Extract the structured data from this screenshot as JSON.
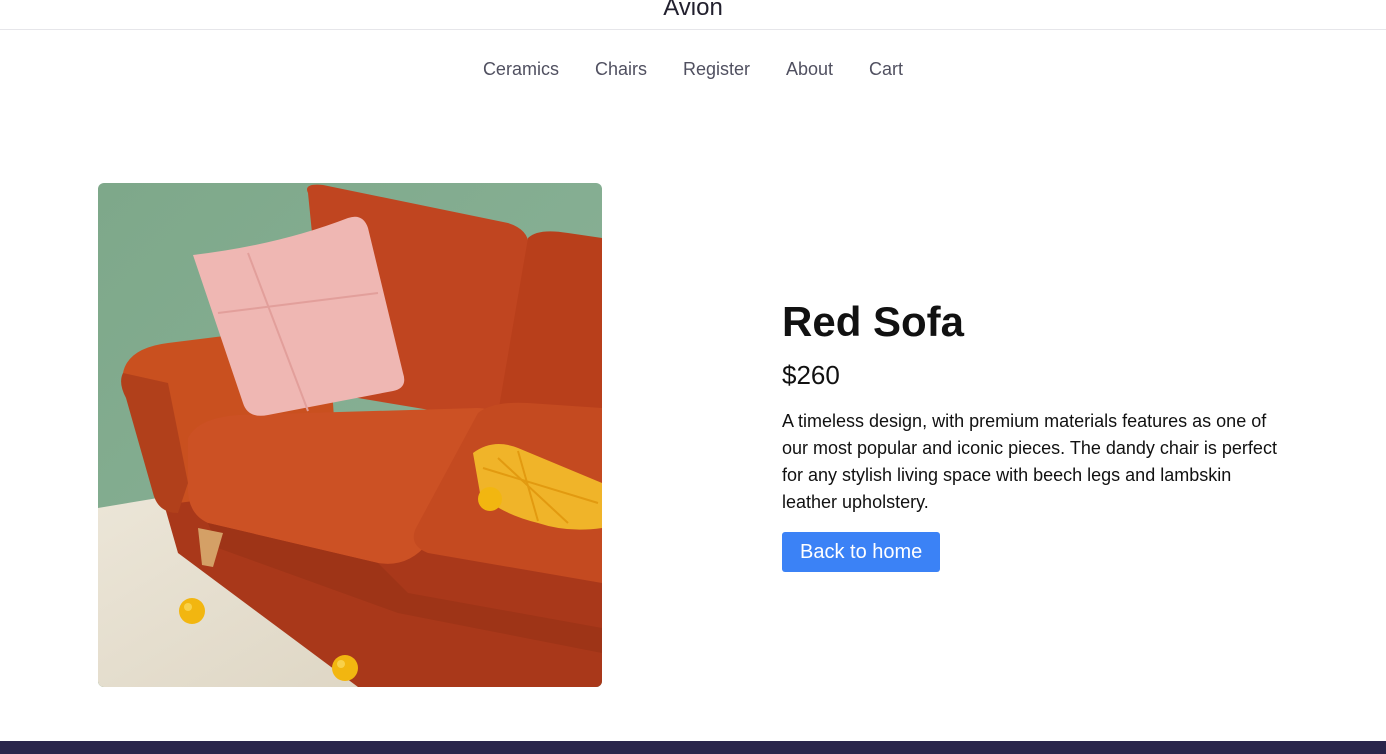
{
  "header": {
    "brand": "Avion"
  },
  "nav": {
    "items": [
      {
        "label": "Ceramics"
      },
      {
        "label": "Chairs"
      },
      {
        "label": "Register"
      },
      {
        "label": "About"
      },
      {
        "label": "Cart"
      }
    ]
  },
  "product": {
    "name": "Red Sofa",
    "price": "$260",
    "description": "A timeless design, with premium materials features as one of our most popular and iconic pieces. The dandy chair is perfect for any stylish living space with beech legs and lambskin leather upholstery.",
    "back_label": "Back to home"
  },
  "colors": {
    "accent": "#3b82f6",
    "footer": "#2a254b",
    "sofa": "#c2461f",
    "wall": "#8aaf94"
  }
}
